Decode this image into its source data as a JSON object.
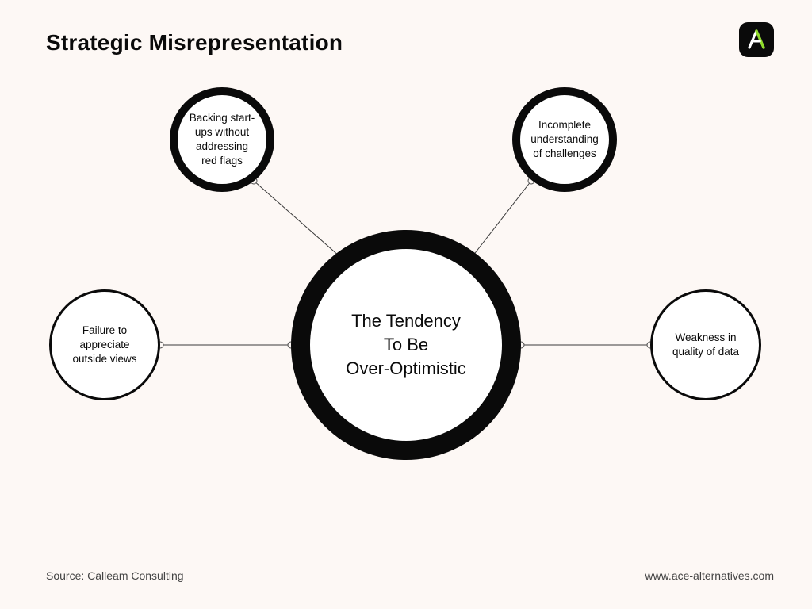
{
  "title": "Strategic Misrepresentation",
  "center": {
    "line1": "The Tendency",
    "line2": "To Be",
    "line3": "Over-Optimistic"
  },
  "nodes": {
    "top_left": "Backing start-ups without addressing red flags",
    "top_right": "Incomplete understanding of challenges",
    "left": "Failure to appreciate outside views",
    "right": "Weakness in quality of data"
  },
  "footer": {
    "source": "Source: Calleam Consulting",
    "url": "www.ace-alternatives.com"
  },
  "logo": {
    "alt": "A"
  }
}
